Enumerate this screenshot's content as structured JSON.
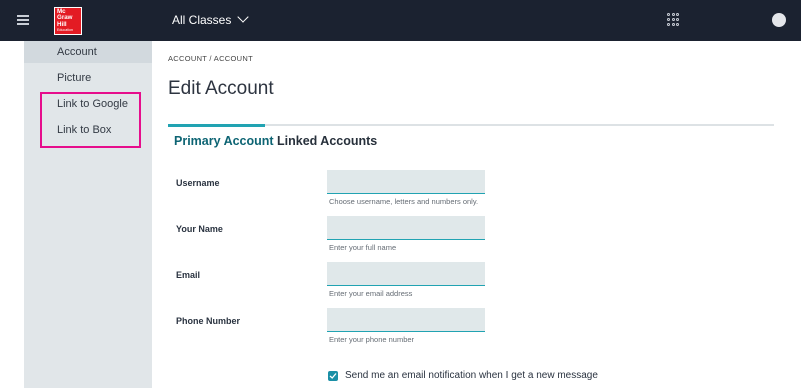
{
  "topbar": {
    "logo_lines": [
      "Mc",
      "Graw",
      "Hill",
      "Education"
    ],
    "class_selector": "All Classes"
  },
  "sidebar": {
    "items": [
      {
        "label": "Account",
        "active": true
      },
      {
        "label": "Picture",
        "active": false
      },
      {
        "label": "Link to Google",
        "active": false
      },
      {
        "label": "Link to Box",
        "active": false
      }
    ],
    "highlight_color": "#e60d8c"
  },
  "breadcrumb": "ACCOUNT / ACCOUNT",
  "page_title": "Edit Account",
  "tabs": {
    "primary": "Primary Account",
    "linked": "Linked Accounts",
    "active_color": "#21a3b2"
  },
  "form": {
    "username": {
      "label": "Username",
      "value": "",
      "hint": "Choose username, letters and numbers only."
    },
    "name": {
      "label": "Your Name",
      "value": "",
      "hint": "Enter your full name"
    },
    "email": {
      "label": "Email",
      "value": "",
      "hint": "Enter your email address"
    },
    "phone": {
      "label": "Phone Number",
      "value": "",
      "hint": "Enter your phone number"
    },
    "notify": {
      "checked": true,
      "label": "Send me an email notification when I get a new message"
    }
  }
}
